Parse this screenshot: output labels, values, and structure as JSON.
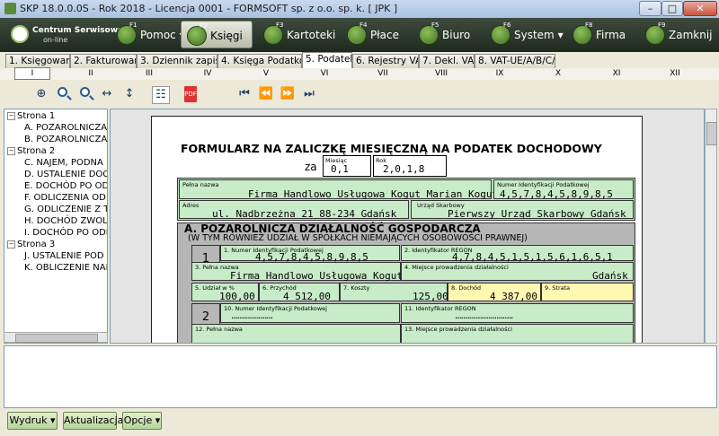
{
  "window": {
    "title": "SKP 18.0.0.0S - Rok 2018 - Licencja 0001 - FORMSOFT sp. z o.o. sp. k.   [ JPK ]"
  },
  "toolbar": {
    "logo_line1": "Centrum Serwisowe",
    "logo_line2": "on-line",
    "buttons": [
      {
        "label": "Pomoc ▾",
        "fkey": "F1"
      },
      {
        "label": "Księgi",
        "fkey": "F2"
      },
      {
        "label": "Kartoteki",
        "fkey": "F3"
      },
      {
        "label": "Płace",
        "fkey": "F4"
      },
      {
        "label": "Biuro",
        "fkey": "F5"
      },
      {
        "label": "System ▾",
        "fkey": "F6"
      },
      {
        "label": "Firma",
        "fkey": "F8"
      },
      {
        "label": "Zamknij",
        "fkey": "F9"
      }
    ]
  },
  "tabs": [
    "1. Księgowanie",
    "2. Fakturowanie",
    "3. Dziennik zapisów",
    "4. Księga Podatkowa",
    "5. Podatek",
    "6. Rejestry VAT",
    "7. Dekl. VAT",
    "8. VAT-UE/A/B/C/K"
  ],
  "active_tab": "5. Podatek",
  "roman_tabs": [
    "I",
    "II",
    "III",
    "IV",
    "V",
    "VI",
    "VII",
    "VIII",
    "IX",
    "X",
    "XI",
    "XII"
  ],
  "tree": [
    {
      "label": "Strona 1",
      "level": 0
    },
    {
      "label": "A. POZAROLNICZA",
      "level": 1
    },
    {
      "label": "B. POZAROLNICZA",
      "level": 1
    },
    {
      "label": "Strona 2",
      "level": 0
    },
    {
      "label": "C. NAJEM, PODNA",
      "level": 1
    },
    {
      "label": "D. USTALENIE DOC",
      "level": 1
    },
    {
      "label": "E. DOCHÓD PO OD",
      "level": 1
    },
    {
      "label": "F. ODLICZENIA OD",
      "level": 1
    },
    {
      "label": "G. ODLICZENIE Z T",
      "level": 1
    },
    {
      "label": "H. DOCHÓD ZWOLI",
      "level": 1
    },
    {
      "label": "I. DOCHÓD PO ODL",
      "level": 1
    },
    {
      "label": "Strona 3",
      "level": 0
    },
    {
      "label": "J. USTALENIE POD",
      "level": 1
    },
    {
      "label": "K. OBLICZENIE NAI",
      "level": 1
    }
  ],
  "form": {
    "title": "FORMULARZ NA ZALICZKĘ MIESIĘCZNĄ NA PODATEK DOCHODOWY",
    "za": "za",
    "month_label": "Miesiąc",
    "month": "0,1",
    "year_label": "Rok",
    "year": "2,0,1,8",
    "full_name_label": "Pełna nazwa",
    "full_name": "Firma Handlowo Usługowa Kogut Marian Kogut",
    "nip_label": "Numer Identyfikacji Podatkowej",
    "nip": "4,5,7,8,4,5,8,9,8,5",
    "address_label": "Adres",
    "address": "ul. Nadbrzeżna 21 88-234 Gdańsk",
    "office_label": "Urząd Skarbowy",
    "office": "Pierwszy Urząd Skarbowy Gdańsk",
    "section_a_title": "A. POZAROLNICZA DZIAŁALNOŚĆ GOSPODARCZA",
    "section_a_sub": "(W TYM RÓWNIEŻ UDZIAŁ W SPÓŁKACH NIEMAJĄCYCH OSOBOWOŚCI PRAWNEJ)",
    "row1": {
      "num": "1",
      "nip_label": "1. Numer Identyfikacji Podatkowej",
      "nip": "4,5,7,8,4,5,8,9,8,5",
      "regon_label": "2. Identyfikator REGON",
      "regon": "4,7,8,4,5,1,5,1,5,6,1,6,5,1",
      "name_label": "3. Pełna nazwa",
      "name": "Firma Handlowo Usługowa Kogut",
      "place_label": "4. Miejsce prowadzenia działalności",
      "place": "Gdańsk",
      "share_label": "5. Udział w %",
      "share": "100,00",
      "income_label": "6. Przychód",
      "income": "4 512,00",
      "costs_label": "7. Koszty",
      "costs": "125,00",
      "profit_label": "8. Dochód",
      "profit": "4 387,00",
      "loss_label": "9. Strata",
      "loss": ""
    },
    "row2": {
      "num": "2",
      "nip_label": "10. Numer Identyfikacji Podatkowej",
      "regon_label": "11. Identyfikator REGON",
      "name_label": "12. Pełna nazwa",
      "place_label": "13. Miejsce prowadzenia działalności"
    }
  },
  "bottom_buttons": [
    "Wydruk ▾",
    "Aktualizacja",
    "Opcje ▾"
  ]
}
